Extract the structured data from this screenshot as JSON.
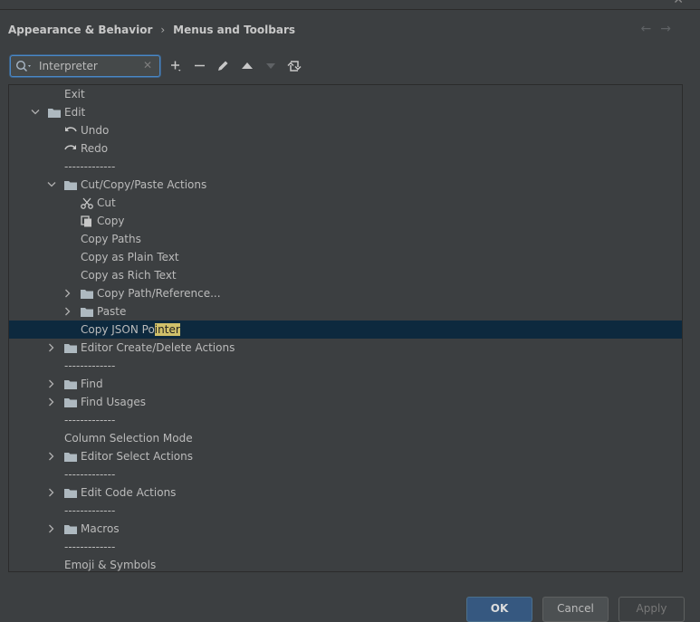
{
  "breadcrumb": {
    "parent": "Appearance & Behavior",
    "current": "Menus and Toolbars"
  },
  "search": {
    "value": "Interpreter"
  },
  "tree": {
    "exit": "Exit",
    "edit": "Edit",
    "undo": "Undo",
    "redo": "Redo",
    "separator": "-------------",
    "cut_copy_paste": "Cut/Copy/Paste Actions",
    "cut": "Cut",
    "copy": "Copy",
    "copy_paths": "Copy Paths",
    "copy_plain": "Copy as Plain Text",
    "copy_rich": "Copy as Rich Text",
    "copy_path_ref": "Copy Path/Reference...",
    "paste": "Paste",
    "copy_json_prefix": "Copy JSON Po",
    "copy_json_match": "inter",
    "editor_create_delete": "Editor Create/Delete Actions",
    "find": "Find",
    "find_usages": "Find Usages",
    "column_selection": "Column Selection Mode",
    "editor_select": "Editor Select Actions",
    "edit_code": "Edit Code Actions",
    "macros": "Macros",
    "emoji": "Emoji & Symbols"
  },
  "buttons": {
    "ok": "OK",
    "cancel": "Cancel",
    "apply": "Apply"
  },
  "colors": {
    "background": "#3c3f41",
    "selection": "#0d293e",
    "highlight": "#d0c06a",
    "accent": "#4a88c7"
  }
}
